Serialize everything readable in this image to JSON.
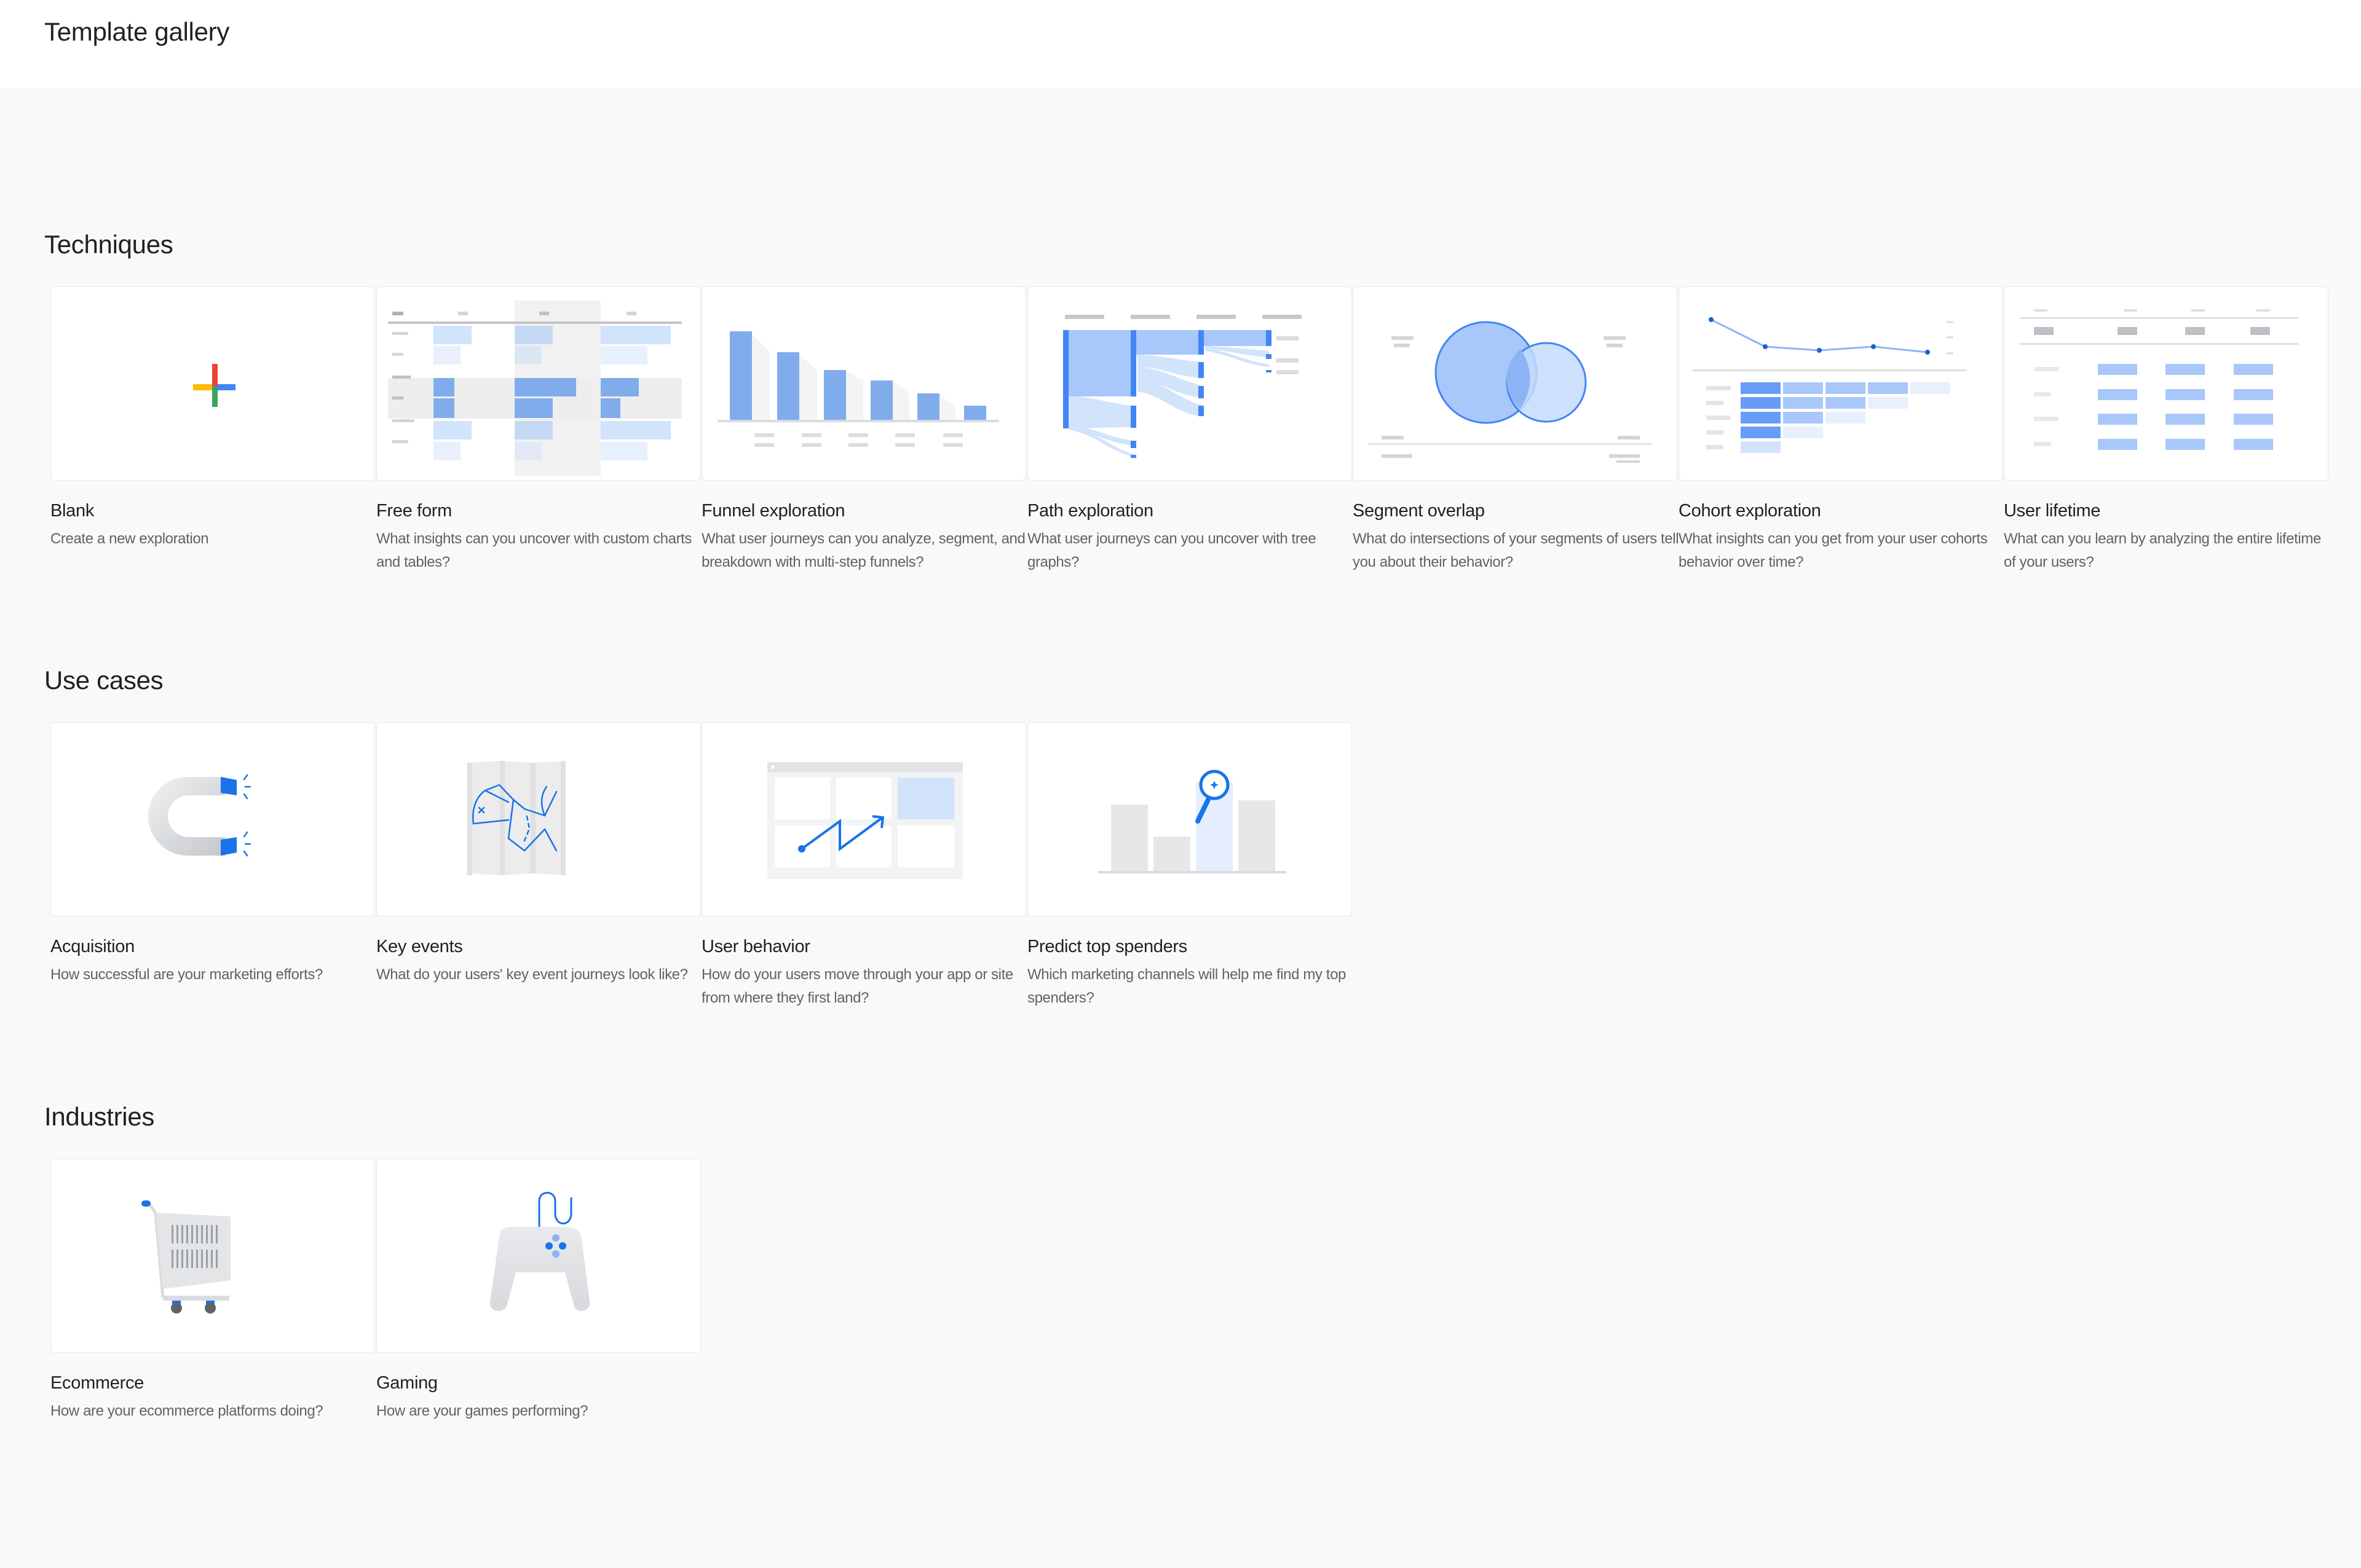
{
  "header": {
    "title": "Template gallery"
  },
  "colors": {
    "accent_blue": "#4285f4",
    "light_blue": "#a8c7fa",
    "pale_blue": "#d2e3fc",
    "gray": "#dadce0",
    "google_red": "#ea4335",
    "google_yellow": "#fbbc04",
    "google_green": "#34a853"
  },
  "sections": [
    {
      "title": "Techniques",
      "cards": [
        {
          "title": "Blank",
          "description": "Create a new exploration",
          "icon": "multicolor-plus-icon"
        },
        {
          "title": "Free form",
          "description": "What insights can you uncover with custom charts and tables?",
          "icon": "freeform-table-illustration"
        },
        {
          "title": "Funnel exploration",
          "description": "What user journeys can you analyze, segment, and breakdown with multi-step funnels?",
          "icon": "funnel-bars-illustration"
        },
        {
          "title": "Path exploration",
          "description": "What user journeys can you uncover with tree graphs?",
          "icon": "path-tree-illustration"
        },
        {
          "title": "Segment overlap",
          "description": "What do intersections of your segments of users tell you about their behavior?",
          "icon": "venn-diagram-illustration"
        },
        {
          "title": "Cohort exploration",
          "description": "What insights can you get from your user cohorts behavior over time?",
          "icon": "cohort-grid-illustration"
        },
        {
          "title": "User lifetime",
          "description": "What can you learn by analyzing the entire lifetime of your users?",
          "icon": "lifetime-table-illustration"
        }
      ]
    },
    {
      "title": "Use cases",
      "cards": [
        {
          "title": "Acquisition",
          "description": "How successful are your marketing efforts?",
          "icon": "magnet-icon"
        },
        {
          "title": "Key events",
          "description": "What do your users' key event journeys look like?",
          "icon": "map-icon"
        },
        {
          "title": "User behavior",
          "description": "How do your users move through your app or site from where they first land?",
          "icon": "zigzag-arrow-icon"
        },
        {
          "title": "Predict top spenders",
          "description": "Which marketing channels will help me find my top spenders?",
          "icon": "magnifier-bars-icon"
        }
      ]
    },
    {
      "title": "Industries",
      "cards": [
        {
          "title": "Ecommerce",
          "description": "How are your ecommerce platforms doing?",
          "icon": "shopping-cart-icon"
        },
        {
          "title": "Gaming",
          "description": "How are your games performing?",
          "icon": "game-controller-icon"
        }
      ]
    }
  ]
}
